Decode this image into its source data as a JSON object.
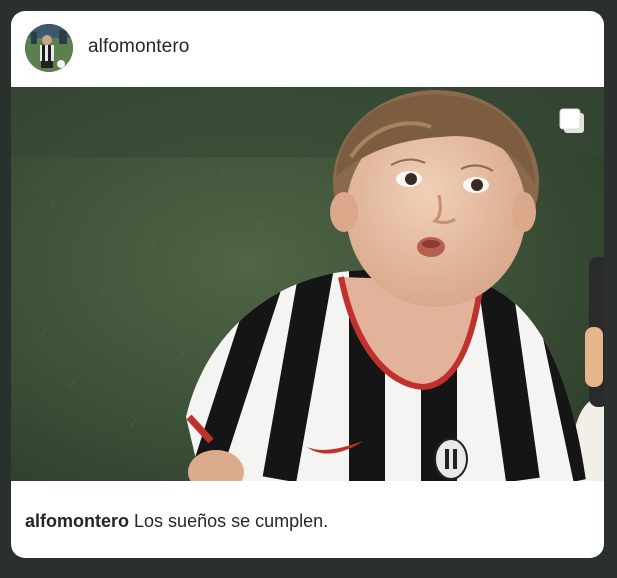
{
  "post": {
    "username": "alfomontero",
    "caption_user": "alfomontero",
    "caption_text": "Los sueños se cumplen."
  },
  "icons": {
    "carousel": "multiple-images-icon"
  },
  "colors": {
    "background": "#29302d",
    "card": "#ffffff",
    "text": "#262626"
  }
}
